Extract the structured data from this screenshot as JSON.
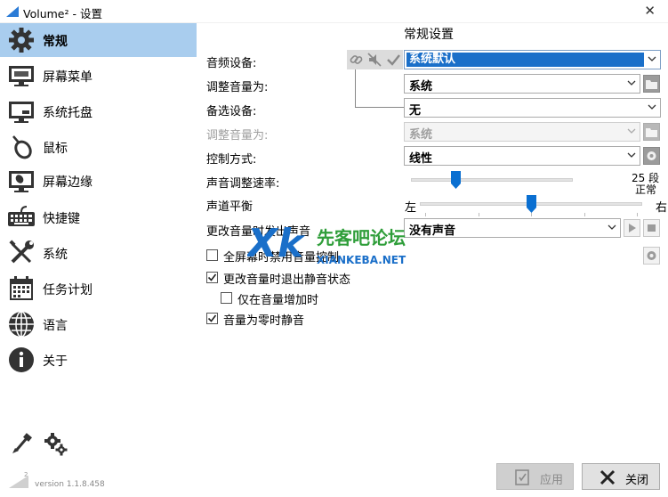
{
  "window": {
    "title": "Volume² - 设置",
    "close_glyph": "✕"
  },
  "sidebar": {
    "items": [
      {
        "label": "常规",
        "icon": "gear-icon",
        "active": true
      },
      {
        "label": "屏幕菜单",
        "icon": "monitor-icon"
      },
      {
        "label": "系统托盘",
        "icon": "tray-icon"
      },
      {
        "label": "鼠标",
        "icon": "mouse-icon"
      },
      {
        "label": "屏幕边缘",
        "icon": "screen-edge-icon"
      },
      {
        "label": "快捷键",
        "icon": "keyboard-icon"
      },
      {
        "label": "系统",
        "icon": "wrench-icon"
      },
      {
        "label": "任务计划",
        "icon": "calendar-icon"
      },
      {
        "label": "语言",
        "icon": "globe-icon"
      },
      {
        "label": "关于",
        "icon": "info-icon"
      }
    ],
    "version": "version 1.1.8.458",
    "version_mark": "2"
  },
  "main": {
    "section_title": "常规设置",
    "audio_device_label": "音频设备:",
    "audio_device_value": "系统默认",
    "adjust_volume_label": "调整音量为:",
    "adjust_volume_value": "系统",
    "alt_device_label": "备选设备:",
    "alt_device_value": "无",
    "alt_adjust_label": "调整音量为:",
    "alt_adjust_value": "系统",
    "control_mode_label": "控制方式:",
    "control_mode_value": "线性",
    "speed_label": "声音调整速率:",
    "speed_value_label": "25 段",
    "speed_level": 0.28,
    "balance_label": "声道平衡",
    "balance_left": "左",
    "balance_right": "右",
    "balance_state": "正常",
    "balance_level": 0.5,
    "sound_on_change_label": "更改音量时发出声音",
    "sound_on_change_value": "没有声音",
    "checkboxes": [
      {
        "label": "全屏幕时禁用音量控制",
        "checked": false
      },
      {
        "label": "更改音量时退出静音状态",
        "checked": true
      },
      {
        "label": "仅在音量增加时",
        "checked": false
      },
      {
        "label": "音量为零时静音",
        "checked": true
      }
    ]
  },
  "footer": {
    "apply_label": "应用",
    "close_label": "关闭"
  },
  "watermark": {
    "brand": "先客吧论坛",
    "url": "XIANKEBA.NET"
  },
  "colors": {
    "accent": "#1a6fc9",
    "active_nav": "#a9cdee",
    "thumb": "#0a6fd1"
  }
}
